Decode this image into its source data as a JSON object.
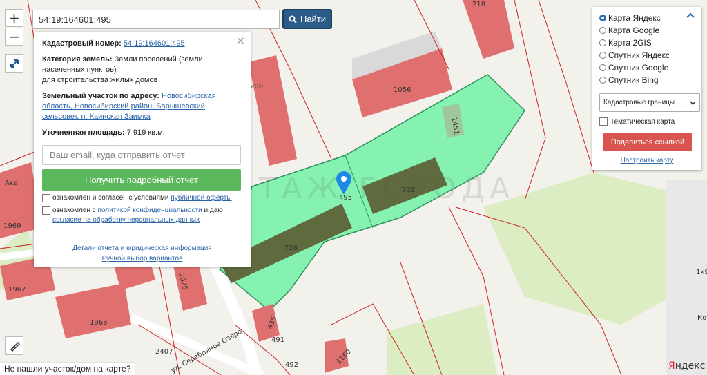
{
  "search": {
    "value": "54:19:164601:495",
    "button_label": "Найти"
  },
  "zoom": {
    "in_label": "+",
    "out_label": "−"
  },
  "info": {
    "cadastral_label": "Кадастровый номер:",
    "cadastral_value": "54:19:164601:495",
    "category_label": "Категория земель:",
    "category_value": "Земли поселений (земли населенных пунктов)",
    "category_use": "для строительства жилых домов",
    "address_label": "Земельный участок по адресу:",
    "address_value": "Новосибирская область, Новосибирский район, Барышевский сельсовет, п. Каинская Заимка",
    "area_label": "Уточненная площадь:",
    "area_value": "7 919 кв.м.",
    "email_placeholder": "Ваш email, куда отправить отчет",
    "report_button": "Получить подробный отчет",
    "consent1_text": "ознакомлен и согласен с условиями",
    "consent1_link": "публичной оферты",
    "consent2_text": "ознакомлен с",
    "consent2_link": "политикой конфиденциальности",
    "consent2_mid": "и даю",
    "consent2_link2": "согласие на обработку персональных данных",
    "details_link": "Детали отчета и юридическая информация",
    "manual_link": "Ручной выбор вариантов"
  },
  "layers": {
    "options": [
      {
        "label": "Карта Яндекс",
        "selected": true
      },
      {
        "label": "Карта Google",
        "selected": false
      },
      {
        "label": "Карта 2GIS",
        "selected": false
      },
      {
        "label": "Спутник Яндекс",
        "selected": false
      },
      {
        "label": "Спутник Google",
        "selected": false
      },
      {
        "label": "Спутник Bing",
        "selected": false
      }
    ],
    "select_value": "Кадастровые границы",
    "thematic_label": "Тематическая карта",
    "share_button": "Поделиться ссылкой",
    "setup_link": "Настроить карту"
  },
  "bottom_bar": "Не нашли участок/дом на карте?",
  "watermark": "ЕТАЖ ГОРОДА",
  "attribution": "Яндекс",
  "map_labels": {
    "plot": "495",
    "b218": "218",
    "b208": "208",
    "b1056": "1056",
    "b1451": "1451",
    "b731": "731",
    "b728": "728",
    "b1969": "1969",
    "b1967": "1967",
    "b1968": "1968",
    "b2025": "2025",
    "b2407": "2407",
    "b436": "436",
    "b491": "491",
    "b492": "492",
    "b1160": "1160",
    "side1": "1к9",
    "side2": "Ко",
    "aka": "Ака",
    "street": "ул. Серебряное Озеро"
  },
  "colors": {
    "plot_fill": "#86f2b1",
    "building_red": "#e07070",
    "building_olive": "#5f6b3e",
    "cadastral_line": "#cc2222",
    "button_blue": "#2b5b86",
    "report_green": "#5cb85c",
    "share_red": "#d9534f"
  }
}
